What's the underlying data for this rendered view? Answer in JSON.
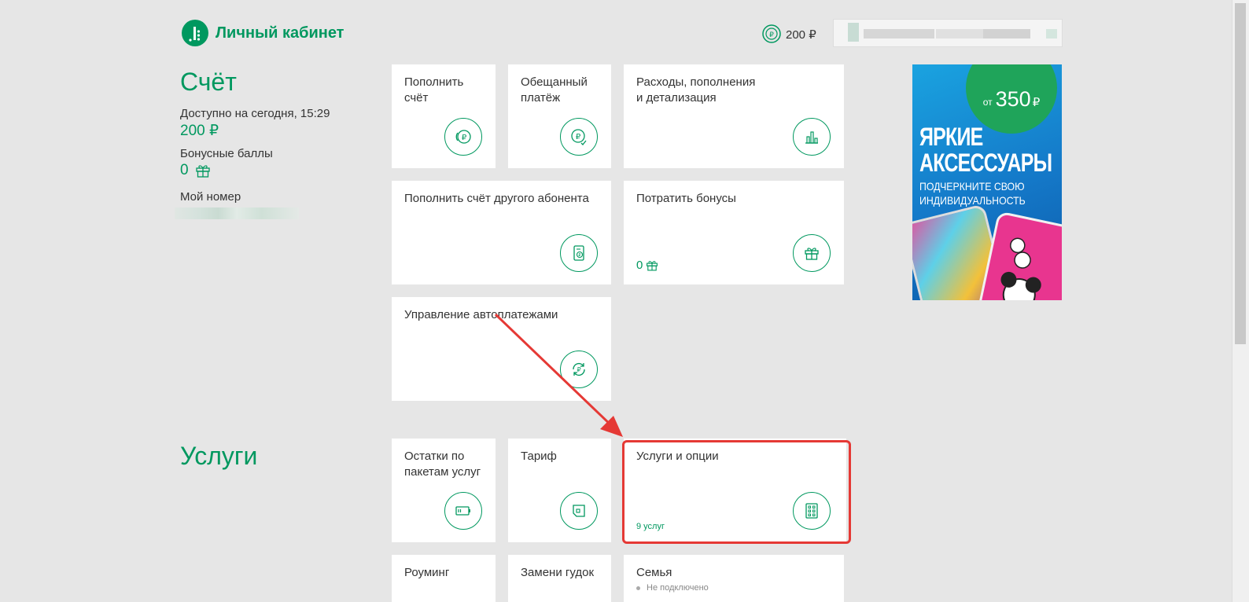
{
  "header": {
    "logo_text": "Личный кабинет",
    "balance": "200 ₽"
  },
  "account": {
    "heading": "Счёт",
    "available_label": "Доступно на сегодня, 15:29",
    "available_value": "200 ₽",
    "bonus_label": "Бонусные баллы",
    "bonus_value": "0",
    "number_label": "Мой номер"
  },
  "account_tiles": [
    {
      "title": "Пополнить\nсчёт",
      "icon": "coins-icon"
    },
    {
      "title": "Обещанный\nплатёж",
      "icon": "promised-payment-icon"
    },
    {
      "title": "Расходы, пополнения\nи детализация",
      "icon": "bar-chart-icon"
    },
    {
      "title": "Пополнить счёт другого абонента",
      "icon": "phone-transfer-icon"
    },
    {
      "title": "Потратить бонусы",
      "icon": "gift-icon",
      "bonus": "0"
    },
    {
      "title": "Управление автоплатежами",
      "icon": "autopay-icon"
    }
  ],
  "services": {
    "heading": "Услуги",
    "tiles": [
      {
        "title": "Остатки по\nпакетам услуг",
        "icon": "battery-icon"
      },
      {
        "title": "Тариф",
        "icon": "sim-card-icon"
      },
      {
        "title": "Услуги и опции",
        "icon": "options-grid-icon",
        "sub": "9 услуг"
      },
      {
        "title": "Роуминг",
        "icon": ""
      },
      {
        "title": "Замени гудок",
        "icon": ""
      },
      {
        "title": "Семья",
        "icon": "",
        "status": "Не подключено"
      }
    ]
  },
  "banner": {
    "price_prefix": "от",
    "price_amount": "350",
    "price_currency": "₽",
    "headline_1": "ЯРКИЕ",
    "headline_2": "АКСЕССУАРЫ",
    "sub_1": "ПОДЧЕРКНИТЕ СВОЮ",
    "sub_2": "ИНДИВИДУАЛЬНОСТЬ"
  },
  "colors": {
    "brand": "#00985f",
    "background": "#e6e6e6",
    "annotation": "#e53935"
  }
}
